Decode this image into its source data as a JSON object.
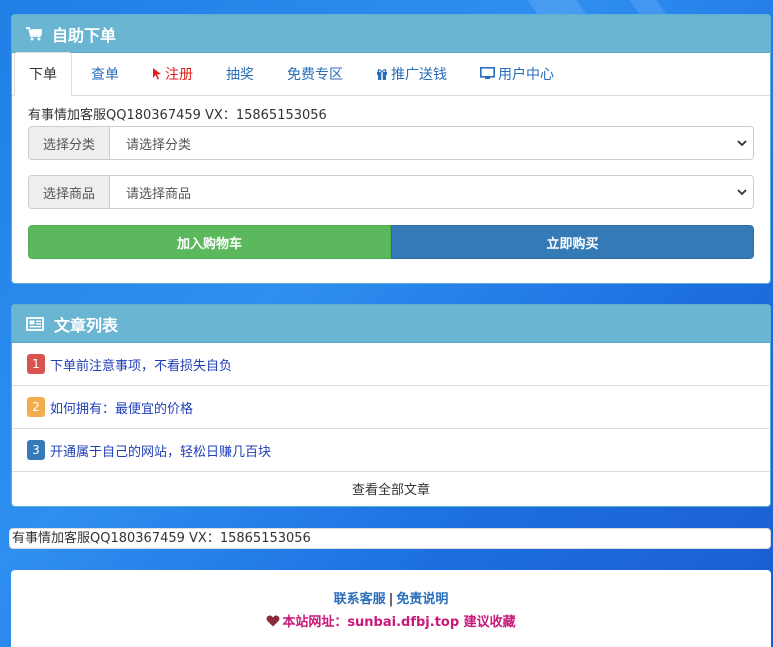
{
  "order_panel": {
    "title": "自助下单",
    "tabs": [
      {
        "label": "下单"
      },
      {
        "label": "查单"
      },
      {
        "label": "注册"
      },
      {
        "label": "抽奖"
      },
      {
        "label": "免费专区"
      },
      {
        "label": "推广送钱"
      },
      {
        "label": "用户中心"
      }
    ],
    "notice": "有事情加客服QQ180367459 VX：15865153056",
    "category": {
      "label": "选择分类",
      "value": "请选择分类"
    },
    "product": {
      "label": "选择商品",
      "value": "请选择商品"
    },
    "add_cart_label": "加入购物车",
    "buy_now_label": "立即购买"
  },
  "articles": {
    "title": "文章列表",
    "items": [
      {
        "index": "1",
        "text": "下单前注意事项，不看损失自负",
        "color": "#d9534f"
      },
      {
        "index": "2",
        "text": "如何拥有：最便宜的价格",
        "color": "#f0ad4e"
      },
      {
        "index": "3",
        "text": "开通属于自己的网站，轻松日赚几百块",
        "color": "#337ab7"
      }
    ],
    "view_all_label": "查看全部文章"
  },
  "contact_strip": "有事情加客服QQ180367459 VX：15865153056",
  "footer": {
    "contact_label": "联系客服",
    "separator": "|",
    "disclaimer_label": "免责说明",
    "site_text": "本站网址：sunbai.dfbj.top 建议收藏"
  }
}
